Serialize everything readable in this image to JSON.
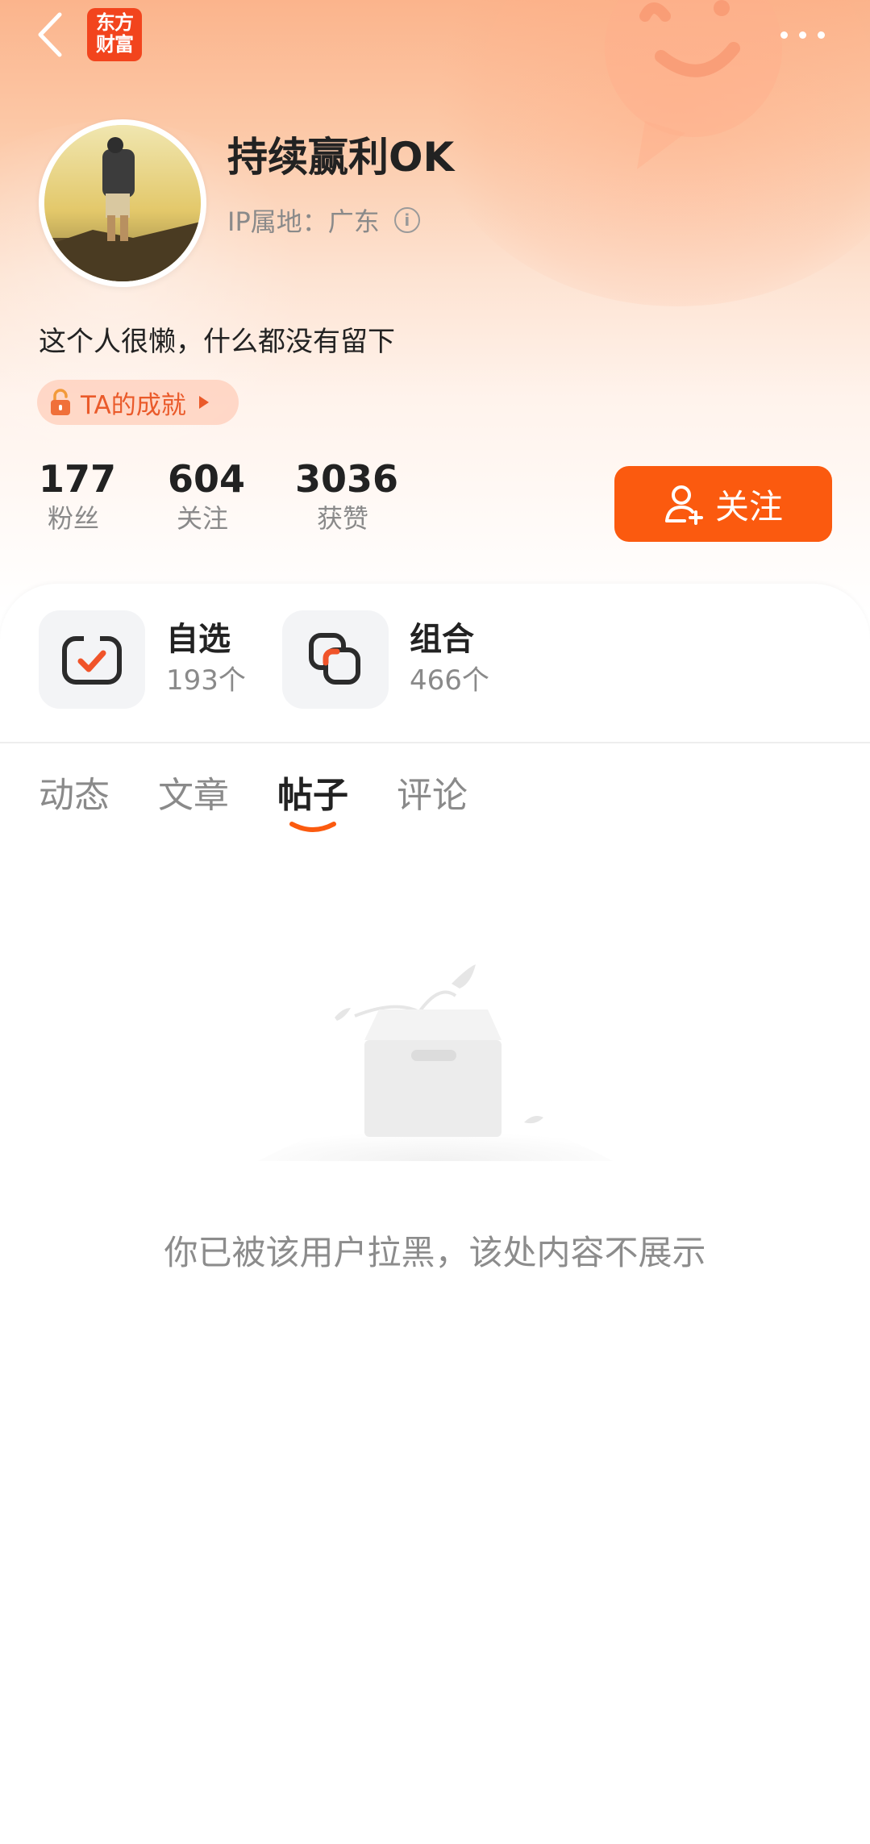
{
  "topbar": {
    "back_icon": "chevron-left-icon",
    "logo_line1": "东方",
    "logo_line2": "财富",
    "more_icon": "more-dots-icon"
  },
  "profile": {
    "username": "持续赢利OK",
    "ip_label": "IP属地：广东",
    "info_icon_glyph": "i",
    "bio": "这个人很懒，什么都没有留下",
    "achievement_label": "TA的成就"
  },
  "stats": [
    {
      "value": "177",
      "label": "粉丝"
    },
    {
      "value": "604",
      "label": "关注"
    },
    {
      "value": "3036",
      "label": "获赞"
    }
  ],
  "follow_button": {
    "label": "关注",
    "icon": "add-user-icon"
  },
  "shortcuts": [
    {
      "title": "自选",
      "count": "193个",
      "icon": "watchlist-check-icon"
    },
    {
      "title": "组合",
      "count": "466个",
      "icon": "portfolio-stack-icon"
    }
  ],
  "tabs": [
    {
      "label": "动态",
      "active": false
    },
    {
      "label": "文章",
      "active": false
    },
    {
      "label": "帖子",
      "active": true
    },
    {
      "label": "评论",
      "active": false
    }
  ],
  "empty_state": {
    "icon": "empty-box-icon",
    "message": "你已被该用户拉黑，该处内容不展示"
  },
  "colors": {
    "accent": "#fb5a0f",
    "logo_bg": "#f2441d",
    "achievement_text": "#ea5a2a",
    "muted_text": "#8a8a8a"
  }
}
